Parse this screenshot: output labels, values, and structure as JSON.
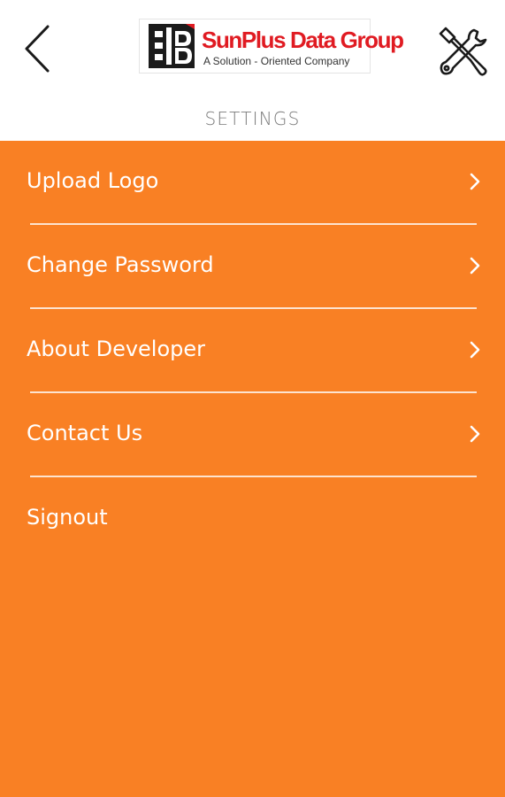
{
  "header": {
    "back_icon": "chevron-left-icon",
    "logo": {
      "title": "SunPlus Data Group",
      "tagline": "A Solution - Oriented Company"
    },
    "tools_icon": "wrench-screwdriver-icon"
  },
  "settings_bar": {
    "title": "SETTINGS"
  },
  "menu": {
    "background_color": "#f98024",
    "items": [
      {
        "label": "Upload Logo",
        "chevron": true
      },
      {
        "label": "Change Password",
        "chevron": true
      },
      {
        "label": "About Developer",
        "chevron": true
      },
      {
        "label": "Contact Us",
        "chevron": true
      },
      {
        "label": "Signout",
        "chevron": false
      }
    ]
  }
}
